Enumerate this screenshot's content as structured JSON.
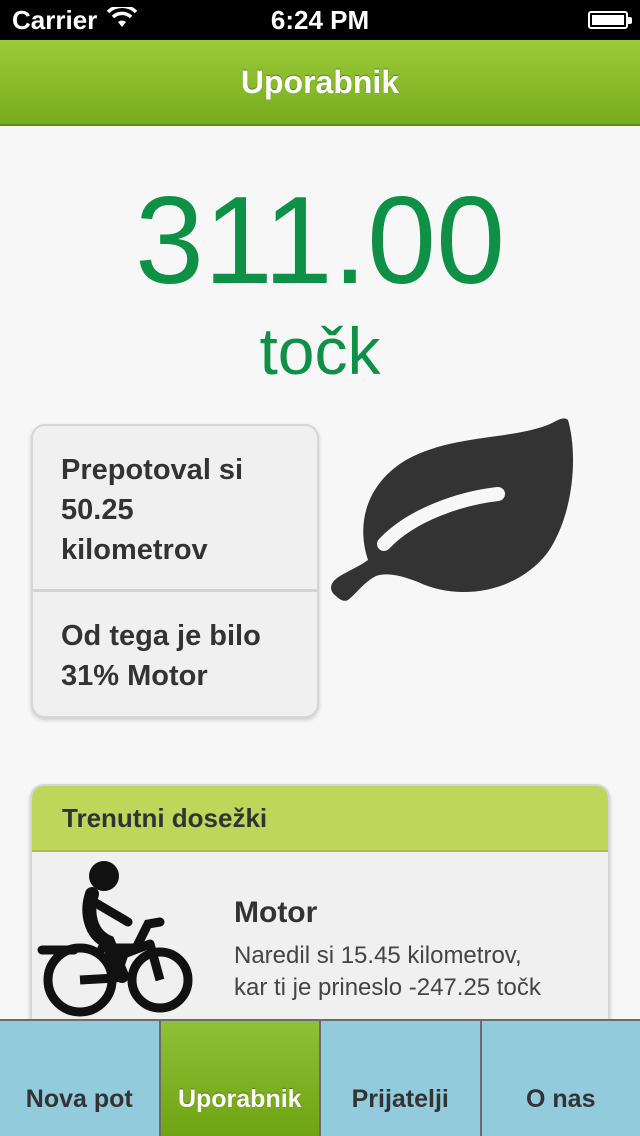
{
  "status_bar": {
    "carrier": "Carrier",
    "time": "6:24 PM",
    "wifi_icon": "wifi-icon",
    "battery_icon": "battery-icon"
  },
  "nav": {
    "title": "Uporabnik"
  },
  "points": {
    "value": "311.00",
    "unit": "točk",
    "color": "#0e9146"
  },
  "stats": {
    "distance_line1": "Prepotoval si",
    "distance_line2": "50.25",
    "distance_line3": "kilometrov",
    "share_line1": "Od tega je bilo",
    "share_line2": "31% Motor"
  },
  "leaf_icon": "leaf-icon",
  "achievements": {
    "header": "Trenutni dosežki",
    "items": [
      {
        "icon": "motorcycle-icon",
        "title": "Motor",
        "desc_line1": "Naredil si 15.45 kilometrov,",
        "desc_line2": "kar ti je prineslo -247.25 točk"
      }
    ]
  },
  "tabs": [
    {
      "label": "Nova pot",
      "active": false
    },
    {
      "label": "Uporabnik",
      "active": true
    },
    {
      "label": "Prijatelji",
      "active": false
    },
    {
      "label": "O nas",
      "active": false
    }
  ],
  "colors": {
    "brand_green": "#78ac1c",
    "achievement_header": "#bfd65a",
    "tab_inactive": "#91cbdc"
  }
}
